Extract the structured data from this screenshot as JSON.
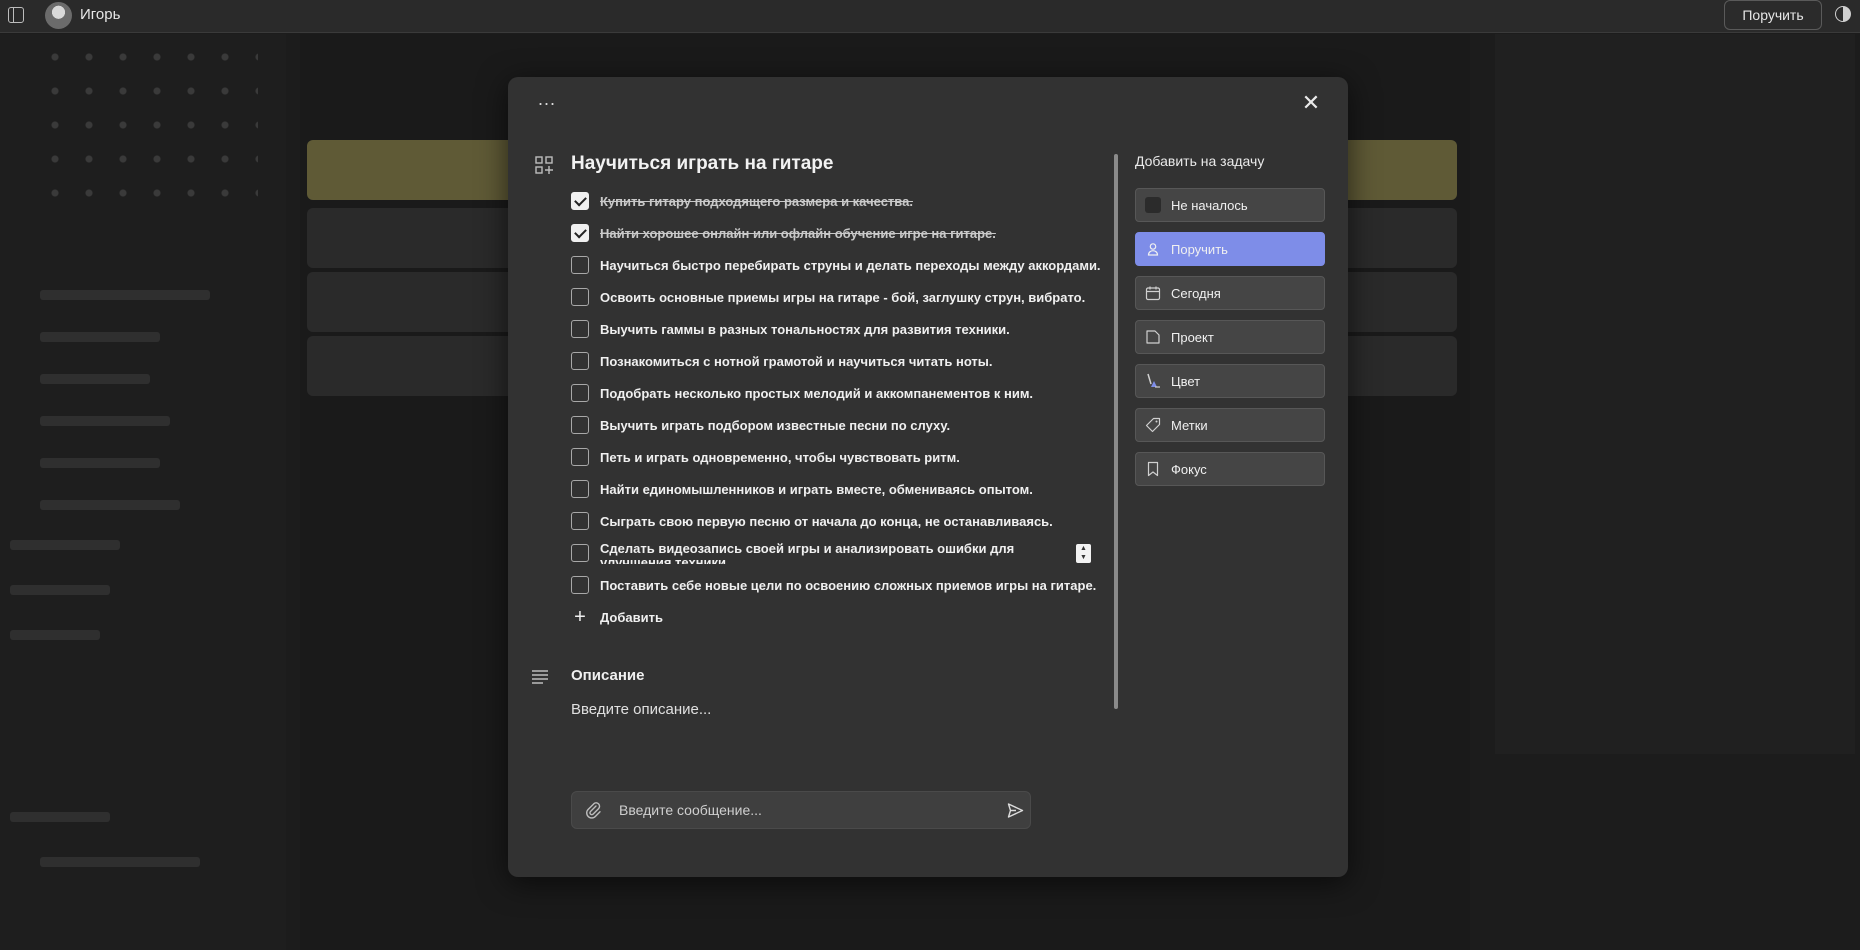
{
  "topbar": {
    "user_name": "Игорь",
    "assign_label": "Поручить"
  },
  "modal": {
    "more_label": "...",
    "close_label": "✕",
    "title": "Научиться играть на гитаре",
    "checklist": [
      {
        "text": "Купить гитару подходящего размера и качества.",
        "done": true
      },
      {
        "text": "Найти хорошее онлайн или офлайн обучение игре на гитаре.",
        "done": true
      },
      {
        "text": "Научиться быстро перебирать струны и делать переходы между аккордами.",
        "done": false
      },
      {
        "text": "Освоить основные приемы игры на гитаре - бой, заглушку струн, вибрато.",
        "done": false
      },
      {
        "text": "Выучить гаммы в разных тональностях для развития техники.",
        "done": false
      },
      {
        "text": "Познакомиться с нотной грамотой и научиться читать ноты.",
        "done": false
      },
      {
        "text": "Подобрать несколько простых мелодий и аккомпанементов к ним.",
        "done": false
      },
      {
        "text": "Выучить играть подбором известные песни по слуху.",
        "done": false
      },
      {
        "text": "Петь и играть одновременно, чтобы чувствовать ритм.",
        "done": false
      },
      {
        "text": "Найти единомышленников и играть вместе, обмениваясь опытом.",
        "done": false
      },
      {
        "text": "Сыграть свою первую песню от начала до конца, не останавливаясь.",
        "done": false
      },
      {
        "text": "Сделать видеозапись своей игры и анализировать ошибки для улучшения техники.",
        "done": false
      },
      {
        "text": "Поставить себе новые цели по освоению сложных приемов игры на гитаре.",
        "done": false
      }
    ],
    "add_label": "Добавить",
    "description_title": "Описание",
    "description_placeholder": "Введите описание...",
    "message_placeholder": "Введите сообщение..."
  },
  "side": {
    "title": "Добавить на задачу",
    "buttons": [
      {
        "label": "Не началось",
        "icon": "status-square-icon"
      },
      {
        "label": "Поручить",
        "icon": "person-icon",
        "active": true
      },
      {
        "label": "Сегодня",
        "icon": "calendar-icon"
      },
      {
        "label": "Проект",
        "icon": "folder-icon"
      },
      {
        "label": "Цвет",
        "icon": "paint-icon"
      },
      {
        "label": "Метки",
        "icon": "tag-icon"
      },
      {
        "label": "Фокус",
        "icon": "bookmark-icon"
      }
    ],
    "active_color": "#7e8de8"
  }
}
